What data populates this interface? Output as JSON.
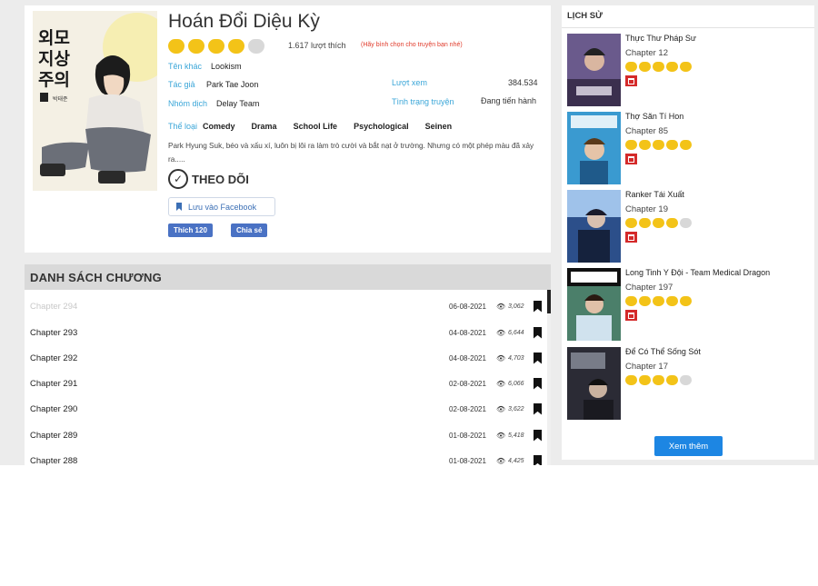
{
  "manga": {
    "title": "Hoán Đổi Diệu Kỳ",
    "rating_stars_filled": 4,
    "rating_stars_total": 5,
    "like_count": "1.617 lượt thích",
    "rate_hint": "(Hãy bình chọn cho truyện bạn nhé)",
    "other_name_label": "Tên khác",
    "other_name": "Lookism",
    "author_label": "Tác giả",
    "author": "Park Tae Joon",
    "group_label": "Nhóm dịch",
    "group": "Delay Team",
    "views_label": "Lượt xem",
    "views": "384.534",
    "status_label": "Tình trạng truyện",
    "status": "Đang tiến hành",
    "genre_label": "Thể loại",
    "genres": [
      "Comedy",
      "Drama",
      "School Life",
      "Psychological",
      "Seinen"
    ],
    "summary": "Park Hyung Suk, béo và xấu xí, luôn bị lôi ra làm trò cười và bắt nạt ở trường. Nhưng có một phép màu đã xảy ra.....",
    "follow_label": "THEO DÕI",
    "save_facebook_label": "Lưu vào Facebook",
    "fb_like_label": "Thích 120",
    "fb_share_label": "Chia sẻ",
    "cover_text_1": "외모",
    "cover_text_2": "지상",
    "cover_text_3": "주의",
    "cover_author": "박태준"
  },
  "chapter_list": {
    "header": "DANH SÁCH CHƯƠNG",
    "chapters": [
      {
        "name": "Chapter 294",
        "date": "06-08-2021",
        "views": "3,062",
        "read": true
      },
      {
        "name": "Chapter 293",
        "date": "04-08-2021",
        "views": "6,644",
        "read": false
      },
      {
        "name": "Chapter 292",
        "date": "04-08-2021",
        "views": "4,703",
        "read": false
      },
      {
        "name": "Chapter 291",
        "date": "02-08-2021",
        "views": "6,066",
        "read": false
      },
      {
        "name": "Chapter 290",
        "date": "02-08-2021",
        "views": "3,622",
        "read": false
      },
      {
        "name": "Chapter 289",
        "date": "01-08-2021",
        "views": "5,418",
        "read": false
      },
      {
        "name": "Chapter 288",
        "date": "01-08-2021",
        "views": "4,425",
        "read": false
      }
    ]
  },
  "history": {
    "title": "LỊCH SỬ",
    "items": [
      {
        "name": "Thực Thư Pháp Sư",
        "chapter": "Chapter 12",
        "stars": 5,
        "color": "#6a5a8c"
      },
      {
        "name": "Thợ Săn Tí Hon",
        "chapter": "Chapter 85",
        "stars": 5,
        "color": "#3a9ad0"
      },
      {
        "name": "Ranker Tái Xuất",
        "chapter": "Chapter 19",
        "stars": 4,
        "color": "#2c4f8a"
      },
      {
        "name": "Long Tinh Y Đội - Team Medical Dragon",
        "chapter": "Chapter 197",
        "stars": 5,
        "color": "#4b7f6a"
      },
      {
        "name": "Để Có Thể Sống Sót",
        "chapter": "Chapter 17",
        "stars": 4,
        "color": "#2b2b35"
      }
    ],
    "see_more_label": "Xem thêm"
  }
}
